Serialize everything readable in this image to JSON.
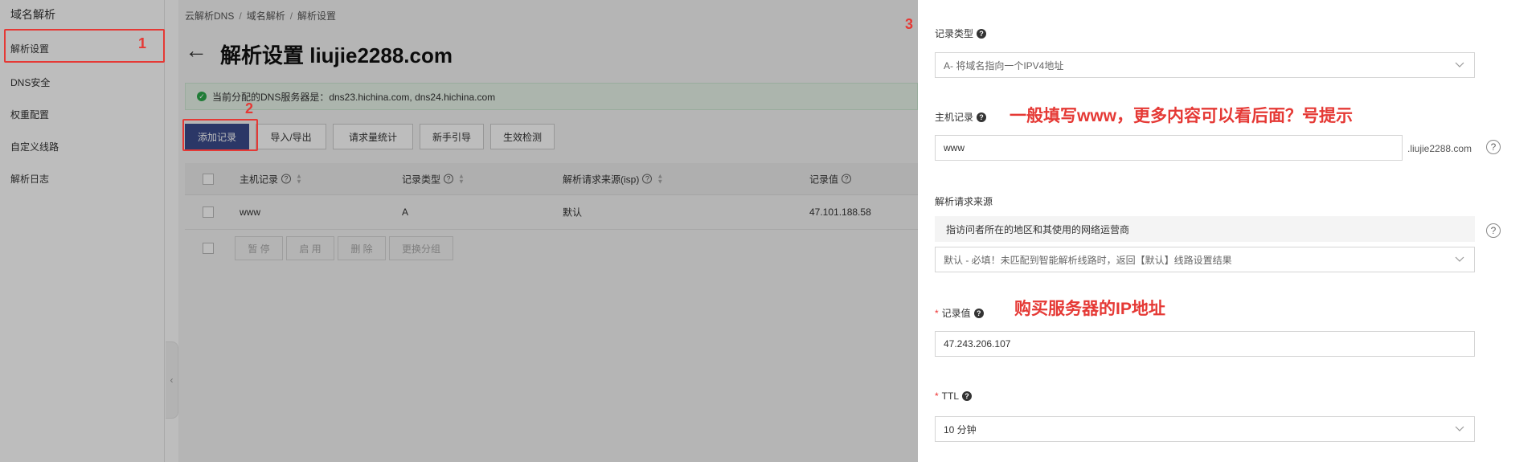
{
  "sidebar": {
    "title": "域名解析",
    "items": [
      {
        "label": "解析设置"
      },
      {
        "label": "DNS安全"
      },
      {
        "label": "权重配置"
      },
      {
        "label": "自定义线路"
      },
      {
        "label": "解析日志"
      }
    ]
  },
  "breadcrumb": [
    "云解析DNS",
    "域名解析",
    "解析设置"
  ],
  "page_title": "解析设置 liujie2288.com",
  "notice": "当前分配的DNS服务器是：dns23.hichina.com, dns24.hichina.com",
  "toolbar": {
    "add_label": "添加记录",
    "import_label": "导入/导出",
    "stats_label": "请求量统计",
    "guide_label": "新手引导",
    "check_label": "生效检测"
  },
  "table": {
    "headers": [
      "主机记录",
      "记录类型",
      "解析请求来源(isp)",
      "记录值"
    ],
    "rows": [
      {
        "host": "www",
        "type": "A",
        "isp": "默认",
        "value": "47.101.188.58"
      }
    ],
    "actions": [
      "暂 停",
      "启 用",
      "删 除",
      "更换分组"
    ]
  },
  "drawer": {
    "record_type": {
      "label": "记录类型",
      "value": "A- 将域名指向一个IPV4地址"
    },
    "host": {
      "label": "主机记录",
      "value": "www",
      "suffix": ".liujie2288.com"
    },
    "isp": {
      "label": "解析请求来源",
      "hint": "指访问者所在的地区和其使用的网络运营商",
      "value": "默认 - 必填！未匹配到智能解析线路时，返回【默认】线路设置结果"
    },
    "record_value": {
      "label": "记录值",
      "value": "47.243.206.107"
    },
    "ttl": {
      "label": "TTL",
      "value": "10 分钟"
    }
  },
  "annotations": {
    "n1": "1",
    "n2": "2",
    "n3": "3",
    "host_tip": "一般填写www，更多内容可以看后面？号提示",
    "value_tip": "购买服务器的IP地址"
  },
  "colors": {
    "primary": "#3a4b8c",
    "annotation": "#e53935",
    "success": "#2aa84a"
  }
}
